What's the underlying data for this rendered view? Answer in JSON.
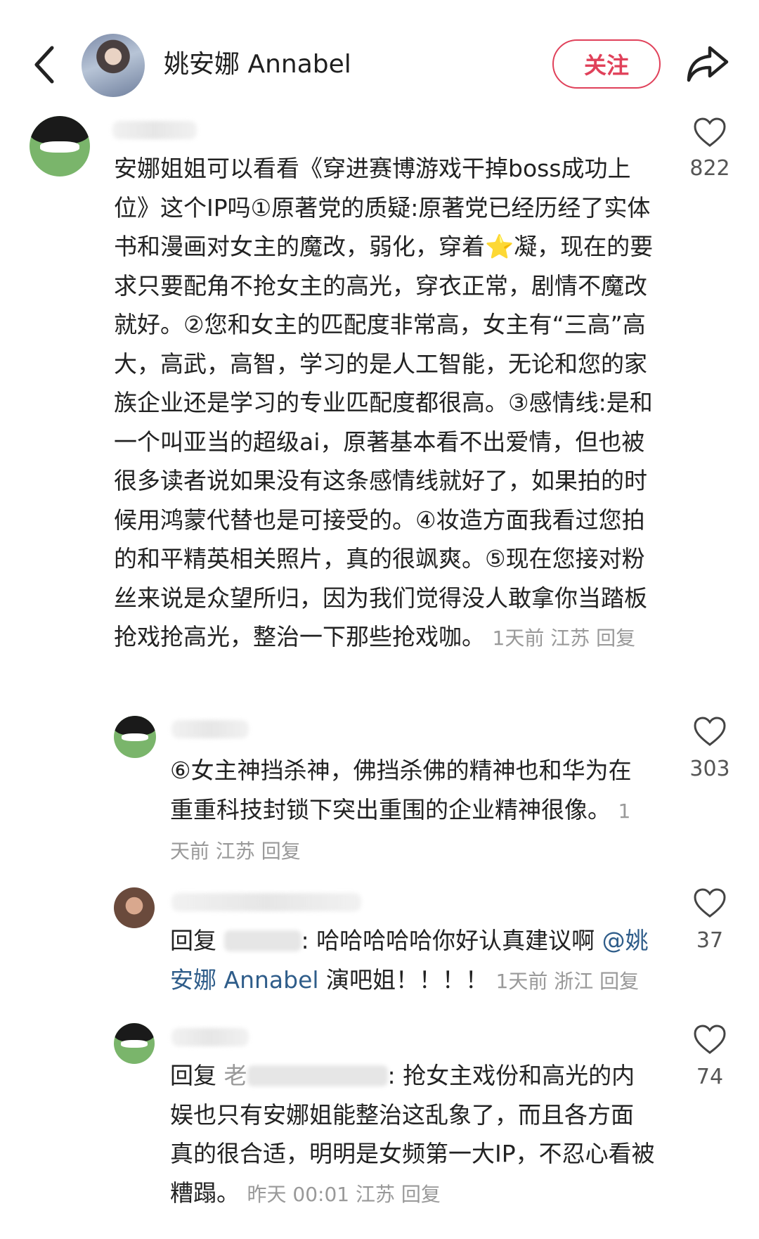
{
  "header": {
    "name": "姚安娜 Annabel",
    "follow_label": "关注"
  },
  "comments": [
    {
      "text": "安娜姐姐可以看看《穿进赛博游戏干掉boss成功上位》这个IP吗①原著党的质疑:原著党已经历经了实体书和漫画对女主的魔改，弱化，穿着⭐凝，现在的要求只要配角不抢女主的高光，穿衣正常，剧情不魔改就好。②您和女主的匹配度非常高，女主有“三高”高大，高武，高智，学习的是人工智能，无论和您的家族企业还是学习的专业匹配度都很高。③感情线:是和一个叫亚当的超级ai，原著基本看不出爱情，但也被很多读者说如果没有这条感情线就好了，如果拍的时候用鸿蒙代替也是可接受的。④妆造方面我看过您拍的和平精英相关照片，真的很飒爽。⑤现在您接对粉丝来说是众望所归，因为我们觉得没人敢拿你当踏板抢戏抢高光，整治一下那些抢戏咖。",
      "meta": "1天前 江苏 回复",
      "likes": "822"
    },
    {
      "text": "⑥女主神挡杀神，佛挡杀佛的精神也和华为在重重科技封锁下突出重围的企业精神很像。",
      "meta": "1天前 江苏 回复",
      "likes": "303"
    },
    {
      "reply_prefix": "回复",
      "text_after": ": 哈哈哈哈哈你好认真建议啊 ",
      "mention": "@姚安娜 Annabel",
      "text_end": " 演吧姐！！！！",
      "meta": "1天前 浙江 回复",
      "likes": "37"
    },
    {
      "reply_prefix": "回复",
      "reply_to": "老",
      "text_after": ": 抢女主戏份和高光的内娱也只有安娜姐能整治这乱象了，而且各方面真的很合适，明明是女频第一大IP，不忍心看被糟蹋。",
      "meta": "昨天 00:01 江苏 回复",
      "likes": "74"
    }
  ],
  "icons": [
    "back-icon",
    "share-icon",
    "heart-icon"
  ]
}
